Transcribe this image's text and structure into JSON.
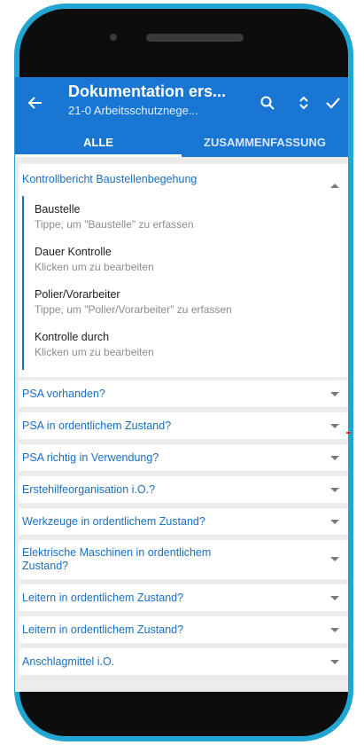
{
  "appbar": {
    "title": "Dokumentation ers...",
    "subtitle": "21-0 Arbeitsschutznege...",
    "back_icon": "arrow-left-icon",
    "search_icon": "search-icon",
    "expand_icon": "unfold-icon",
    "confirm_icon": "check-icon"
  },
  "tabs": [
    {
      "label": "ALLE",
      "active": true
    },
    {
      "label": "ZUSAMMENFASSUNG",
      "active": false
    }
  ],
  "open_section": {
    "title": "Kontrollbericht Baustellenbegehung",
    "fields": [
      {
        "label": "Baustelle",
        "hint": "Tippe, um \"Baustelle\" zu erfassen"
      },
      {
        "label": "Dauer Kontrolle",
        "hint": "Klicken um zu bearbeiten"
      },
      {
        "label": "Polier/Vorarbeiter",
        "hint": "Tippe, um \"Polier/Vorarbeiter\" zu erfassen"
      },
      {
        "label": "Kontrolle durch",
        "hint": "Klicken um zu bearbeiten"
      }
    ]
  },
  "sections": [
    "PSA vorhanden?",
    "PSA in ordentlichem Zustand?",
    "PSA richtig in Verwendung?",
    "Erstehilfeorganisation i.O.?",
    "Werkzeuge in ordentlichem Zustand?",
    "Elektrische Maschinen in ordentlichem Zustand?",
    "Leitern in ordentlichem Zustand?",
    "Leitern in ordentlichem Zustand?",
    "Anschlagmittel i.O."
  ],
  "colors": {
    "accent": "#1976d2",
    "phone_frame": "#22a6d1",
    "link": "#1a6fc0"
  }
}
